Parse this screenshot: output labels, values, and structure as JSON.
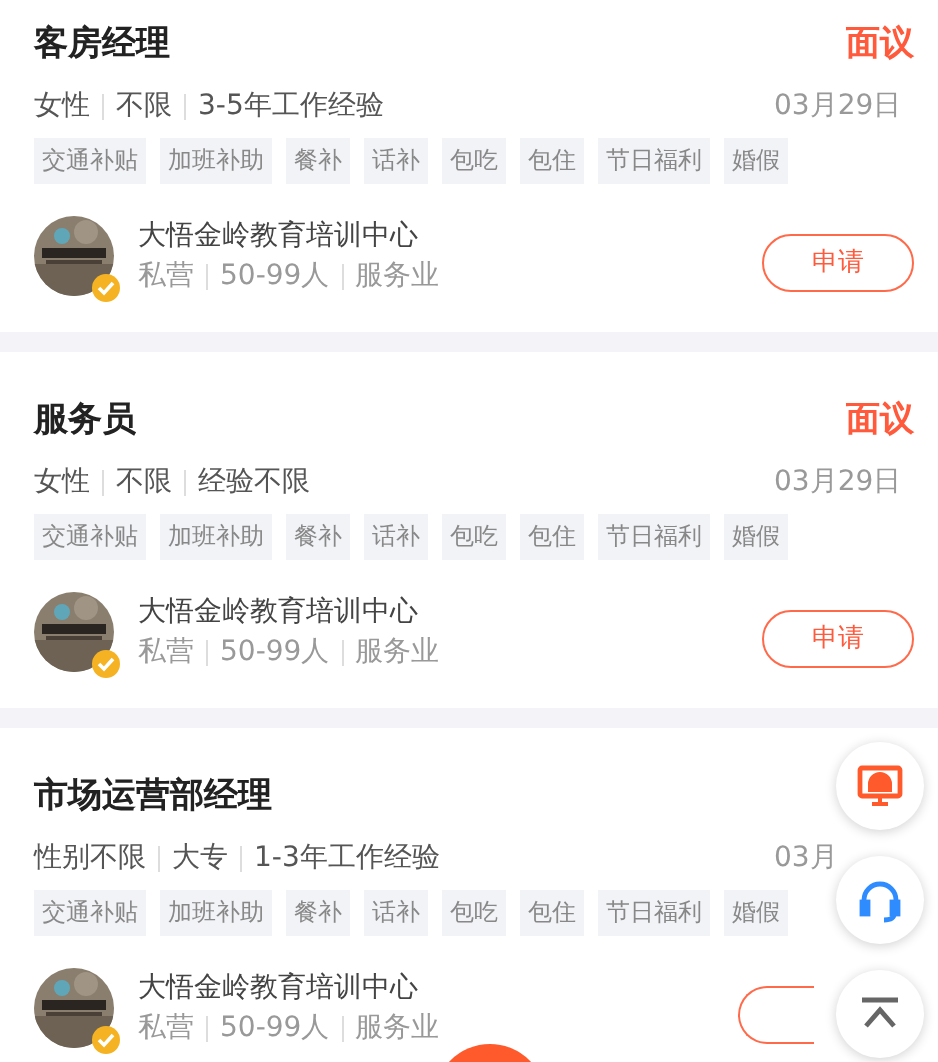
{
  "jobs": [
    {
      "title": "客房经理",
      "salary": "面议",
      "requirements": [
        "女性",
        "不限",
        "3-5年工作经验"
      ],
      "date": "03月29日",
      "benefits": [
        "交通补贴",
        "加班补助",
        "餐补",
        "话补",
        "包吃",
        "包住",
        "节日福利",
        "婚假"
      ],
      "company": {
        "name": "大悟金岭教育培训中心",
        "verified": true,
        "details": [
          "私营",
          "50-99人",
          "服务业"
        ]
      },
      "apply_label": "申请"
    },
    {
      "title": "服务员",
      "salary": "面议",
      "requirements": [
        "女性",
        "不限",
        "经验不限"
      ],
      "date": "03月29日",
      "benefits": [
        "交通补贴",
        "加班补助",
        "餐补",
        "话补",
        "包吃",
        "包住",
        "节日福利",
        "婚假"
      ],
      "company": {
        "name": "大悟金岭教育培训中心",
        "verified": true,
        "details": [
          "私营",
          "50-99人",
          "服务业"
        ]
      },
      "apply_label": "申请"
    },
    {
      "title": "市场运营部经理",
      "requirements": [
        "性别不限",
        "大专",
        "1-3年工作经验"
      ],
      "date": "03月",
      "benefits": [
        "交通补贴",
        "加班补助",
        "餐补",
        "话补",
        "包吃",
        "包住",
        "节日福利",
        "婚假"
      ],
      "company": {
        "name": "大悟金岭教育培训中心",
        "verified": true,
        "details": [
          "私营",
          "50-99人",
          "服务业"
        ]
      }
    }
  ],
  "floating_buttons": [
    {
      "kind": "monitor"
    },
    {
      "kind": "support"
    },
    {
      "kind": "top"
    }
  ]
}
